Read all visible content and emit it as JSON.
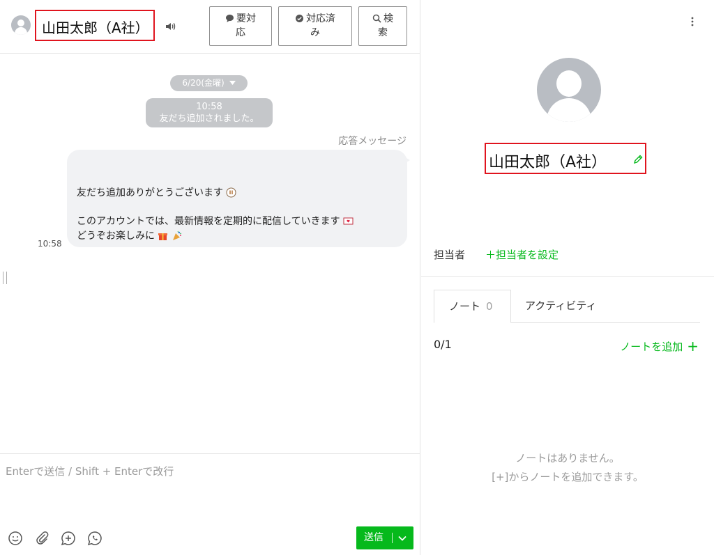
{
  "header": {
    "contact_name": "山田太郎（A社）",
    "buttons": {
      "needs_response": "要対\n応",
      "resolved": "対応済\nみ",
      "search": "検\n索"
    }
  },
  "chat": {
    "date": "6/20(金曜)",
    "system_message_time": "10:58",
    "system_message_text": "友だち追加されました。",
    "response_label": "応答メッセージ",
    "message": {
      "line1": "友だち追加ありがとうございます",
      "line2": "このアカウントでは、最新情報を定期的に配信していきます",
      "line3": "どうぞお楽しみに"
    },
    "message_time": "10:58"
  },
  "composer": {
    "placeholder": "Enterで送信 / Shift + Enterで改行",
    "send_label": "送信"
  },
  "profile": {
    "name": "山田太郎（A社）",
    "assignee_label": "担当者",
    "assignee_link": "＋担当者を設定",
    "tabs": [
      {
        "label": "ノート",
        "count": "0"
      },
      {
        "label": "アクティビティ"
      }
    ],
    "note_count": "0/1",
    "add_note": "ノートを追加",
    "empty_line1": "ノートはありません。",
    "empty_line2": "[+]からノートを追加できます。"
  },
  "colors": {
    "accent_green": "#06b91c",
    "highlight_red": "#e0141e"
  }
}
